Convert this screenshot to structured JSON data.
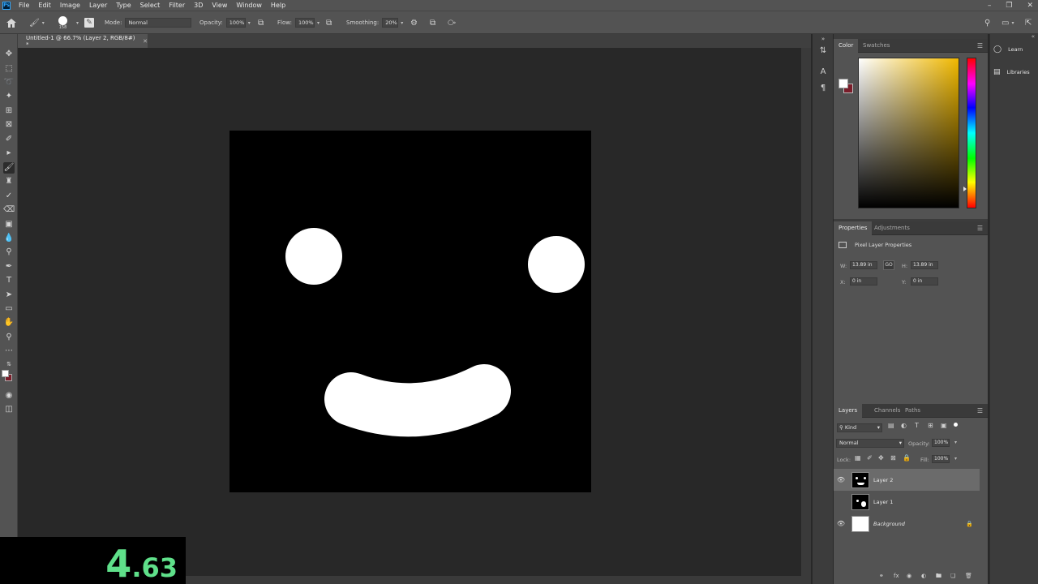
{
  "menubar": {
    "logo": "Ps",
    "items": [
      "File",
      "Edit",
      "Image",
      "Layer",
      "Type",
      "Select",
      "Filter",
      "3D",
      "View",
      "Window",
      "Help"
    ]
  },
  "options": {
    "brush_size": "158",
    "mode_label": "Mode:",
    "mode_value": "Normal",
    "opacity_label": "Opacity:",
    "opacity_value": "100%",
    "flow_label": "Flow:",
    "flow_value": "100%",
    "smoothing_label": "Smoothing:",
    "smoothing_value": "20%"
  },
  "document": {
    "tab_title": "Untitled-1 @ 66.7% (Layer 2, RGB/8#) *"
  },
  "panels": {
    "color_tabs": [
      "Color",
      "Swatches"
    ],
    "properties_tabs": [
      "Properties",
      "Adjustments"
    ],
    "properties_title": "Pixel Layer Properties",
    "w_label": "W:",
    "w_value": "13.89 in",
    "h_label": "H:",
    "h_value": "13.89 in",
    "link_label": "GO",
    "x_label": "X:",
    "x_value": "0 in",
    "y_label": "Y:",
    "y_value": "0 in",
    "layers_tabs": [
      "Layers",
      "Channels",
      "Paths"
    ],
    "kind_value": "Kind",
    "blend_value": "Normal",
    "opacity_label": "Opacity:",
    "opacity_value": "100%",
    "lock_label": "Lock:",
    "fill_label": "Fill:",
    "fill_value": "100%",
    "layers": [
      {
        "name": "Layer 2",
        "visible": true,
        "selected": true
      },
      {
        "name": "Layer 1",
        "visible": false,
        "selected": false
      },
      {
        "name": "Background",
        "visible": true,
        "selected": false,
        "locked": true
      }
    ]
  },
  "right_dock": {
    "learn": "Learn",
    "libraries": "Libraries"
  },
  "colors": {
    "foreground": "#ffffff",
    "background": "#7a1d2a",
    "canvas": "#000000"
  },
  "overlay": {
    "timer_big": "4",
    "timer_small": ".63"
  }
}
